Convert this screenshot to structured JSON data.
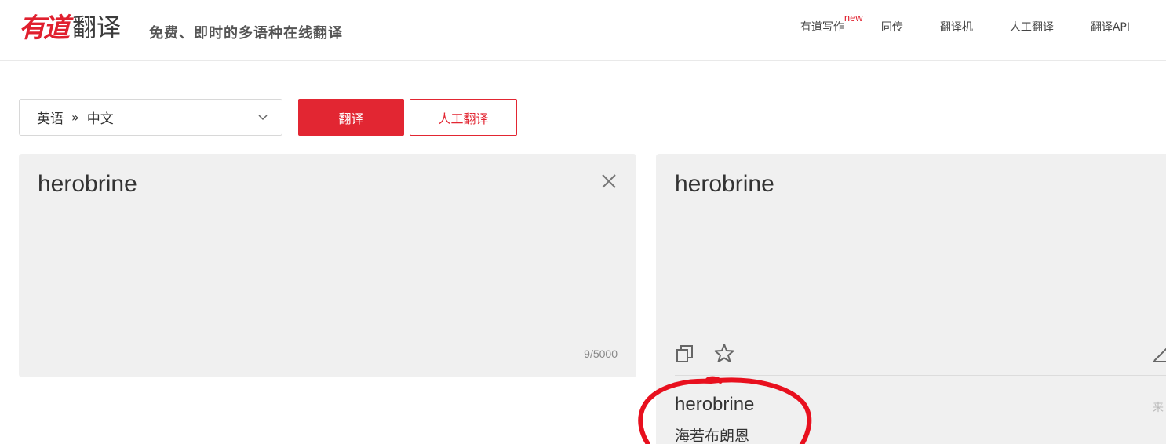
{
  "header": {
    "logo_brand": "有道",
    "logo_product": "翻译",
    "slogan": "免费、即时的多语种在线翻译",
    "nav": [
      {
        "label": "有道写作",
        "badge": "new"
      },
      {
        "label": "同传"
      },
      {
        "label": "翻译机"
      },
      {
        "label": "人工翻译"
      },
      {
        "label": "翻译API"
      }
    ]
  },
  "toolbar": {
    "source_lang": "英语",
    "separator": "»",
    "target_lang": "中文",
    "translate_label": "翻译",
    "human_translate_label": "人工翻译"
  },
  "input": {
    "text": "herobrine",
    "char_count": "9/5000"
  },
  "output": {
    "text": "herobrine",
    "dict_word": "herobrine",
    "dict_meaning": "海若布朗恩",
    "dict_source": "来"
  },
  "colors": {
    "brand_red": "#e22632",
    "panel_bg": "#f0f0f0",
    "annotation_red": "#e8101e"
  },
  "icons": [
    "chevron-down-icon",
    "close-icon",
    "copy-icon",
    "star-icon",
    "edit-icon"
  ]
}
